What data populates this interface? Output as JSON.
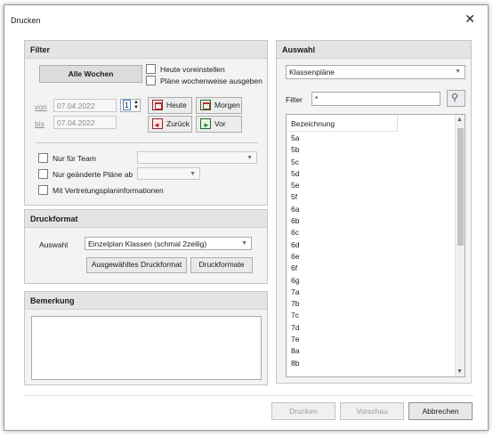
{
  "window": {
    "title": "Drucken",
    "close_glyph": "✕"
  },
  "filter": {
    "header": "Filter",
    "all_weeks_button": "Alle Wochen",
    "preset_today": "Heute voreinstellen",
    "weekly_output": "Pläne wochenweise ausgeben",
    "from_label": "von",
    "from_value": "07.04.2022",
    "to_label": "bis",
    "to_value": "07.04.2022",
    "spinner_value": "1",
    "today_button": "Heute",
    "tomorrow_button": "Morgen",
    "back_button": "Zurück",
    "forward_button": "Vor",
    "team_only": "Nur für Team",
    "changed_only": "Nur geänderte Pläne ab",
    "with_substitution": "Mit Vertretungsplaninformationen"
  },
  "druckformat": {
    "header": "Druckformat",
    "selection_label": "Auswahl",
    "selection_value": "Einzelplan Klassen (schmal 2zeilig)",
    "selected_format_button": "Ausgewähltes Druckformat",
    "formats_button": "Druckformate"
  },
  "bemerkung": {
    "header": "Bemerkung"
  },
  "auswahl": {
    "header": "Auswahl",
    "type_value": "Klassenpläne",
    "filter_label": "Filter",
    "filter_value": "*",
    "column_header": "Bezeichnung",
    "items": [
      "5a",
      "5b",
      "5c",
      "5d",
      "5e",
      "5f",
      "6a",
      "6b",
      "6c",
      "6d",
      "6e",
      "6f",
      "6g",
      "7a",
      "7b",
      "7c",
      "7d",
      "7e",
      "8a",
      "8b"
    ]
  },
  "footer": {
    "print_button": "Drucken",
    "preview_button": "Vorschau",
    "cancel_button": "Abbrechen"
  },
  "icons": [
    "close-icon",
    "calendar-icon",
    "arrow-left-icon",
    "arrow-right-icon",
    "dropdown-arrow-icon",
    "filter-icon",
    "scroll-up-icon",
    "scroll-down-icon"
  ]
}
